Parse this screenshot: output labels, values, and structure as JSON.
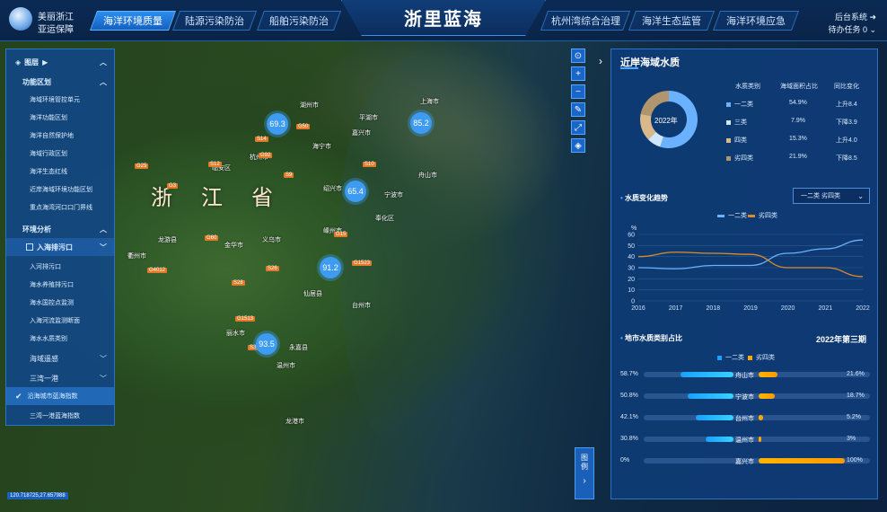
{
  "header": {
    "brand_line1": "美丽浙江",
    "brand_line2": "亚运保障",
    "title": "浙里蓝海",
    "tabs": [
      "海洋环境质量",
      "陆源污染防治",
      "船舶污染防治",
      "杭州湾综合治理",
      "海洋生态监管",
      "海洋环境应急"
    ],
    "backend": "后台系统",
    "todo": "待办任务 0"
  },
  "left_panel": {
    "layers_title": "图层",
    "functional_zoning": "功能区划",
    "zoning_items": [
      "海域环境管控单元",
      "海洋功能区划",
      "海洋自然保护地",
      "海域行政区划",
      "海洋生态红线",
      "近岸海域环境功能区划",
      "重点海湾河口口门界线"
    ],
    "env_analysis": "环境分析",
    "sea_outfall": "入海排污口",
    "outfall_items": [
      "入河排污口",
      "海水养殖排污口",
      "海水国控点监测",
      "入海河流监测断面",
      "海水水质类别"
    ],
    "sea_remote": "海域遥感",
    "sanwan": "三湾一港",
    "sub_items": [
      "沿海城市蓝海指数",
      "三湾一港蓝海指数"
    ]
  },
  "map": {
    "province": "浙江省",
    "clusters": [
      "69.3",
      "85.2",
      "65.4",
      "91.2",
      "93.5"
    ],
    "cities": [
      "湖州市",
      "嘉兴市",
      "杭州市",
      "绍兴市",
      "宁波市",
      "舟山市",
      "金华市",
      "衢州市",
      "台州市",
      "丽水市",
      "温州市",
      "上海市",
      "临安区",
      "义乌市",
      "龙游县",
      "奉化区",
      "平湖市",
      "海宁市",
      "嵊州市",
      "仙居县",
      "永嘉县",
      "龙港市"
    ],
    "roads": [
      "G50",
      "S12",
      "G25",
      "S14",
      "G60",
      "G92",
      "S9",
      "G15",
      "S26",
      "G1523",
      "G4012",
      "S28",
      "G1513",
      "S33",
      "S10",
      "G3"
    ],
    "coords": "120.718725,27.657988",
    "legend": "图例"
  },
  "right_panel": {
    "title": "近岸海域水质",
    "donut_center": "2022年",
    "table_headers": [
      "水质类别",
      "海域面积占比",
      "同比变化"
    ],
    "table_rows": [
      {
        "label": "一二类",
        "ratio": "54.9%",
        "change": "上升8.4",
        "color": "#6ab2ff"
      },
      {
        "label": "三类",
        "ratio": "7.9%",
        "change": "下降3.9",
        "color": "#cfe6ff"
      },
      {
        "label": "四类",
        "ratio": "15.3%",
        "change": "上升4.0",
        "color": "#d9b98a"
      },
      {
        "label": "劣四类",
        "ratio": "21.9%",
        "change": "下降8.5",
        "color": "#b0956e"
      }
    ],
    "trend_title": "水质变化趋势",
    "trend_select": "一二类 劣四类",
    "trend_legend": [
      "一二类",
      "劣四类"
    ],
    "trend_unit": "%",
    "share_title": "地市水质类别占比",
    "share_period": "2022年第三期",
    "share_legend": [
      "一二类",
      "劣四类"
    ],
    "share_rows": [
      {
        "city": "舟山市",
        "left": "58.7%",
        "right": "21.6%"
      },
      {
        "city": "宁波市",
        "left": "50.8%",
        "right": "18.7%"
      },
      {
        "city": "台州市",
        "left": "42.1%",
        "right": "5.2%"
      },
      {
        "city": "温州市",
        "left": "30.8%",
        "right": "3%"
      },
      {
        "city": "嘉兴市",
        "left": "0%",
        "right": "100%"
      }
    ]
  },
  "chart_data": {
    "type": "line",
    "x": [
      2016,
      2017,
      2018,
      2019,
      2020,
      2021,
      2022
    ],
    "series": [
      {
        "name": "一二类",
        "values": [
          30,
          29,
          32,
          32,
          43,
          47,
          55
        ],
        "color": "#6ab2ff"
      },
      {
        "name": "劣四类",
        "values": [
          40,
          44,
          43,
          42,
          30,
          30,
          22
        ],
        "color": "#e08a2a"
      }
    ],
    "ylim": [
      0,
      60
    ],
    "yticks": [
      0,
      10,
      20,
      30,
      40,
      50,
      60
    ],
    "ylabel": "%"
  },
  "donut_data": {
    "type": "pie",
    "values": [
      54.9,
      7.9,
      15.3,
      21.9
    ],
    "colors": [
      "#6ab2ff",
      "#cfe6ff",
      "#d9b98a",
      "#b0956e"
    ]
  },
  "share_values": {
    "left": [
      58.7,
      50.8,
      42.1,
      30.8,
      0
    ],
    "right": [
      21.6,
      18.7,
      5.2,
      3,
      100
    ]
  }
}
